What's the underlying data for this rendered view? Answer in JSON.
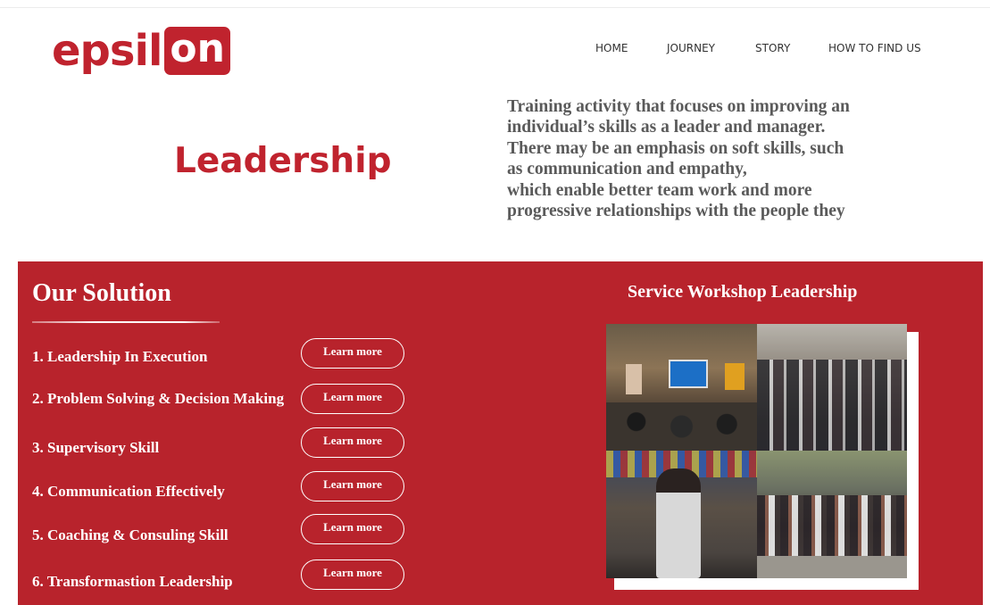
{
  "logo": {
    "text_main": "epsil",
    "text_box": "on"
  },
  "nav": [
    {
      "label": "HOME"
    },
    {
      "label": "JOURNEY"
    },
    {
      "label": "STORY"
    },
    {
      "label": "HOW TO FIND US"
    }
  ],
  "hero": {
    "title": "Leadership",
    "description": "Training activity that focuses on improving an\nindividual’s skills as a leader and manager.\n There may be an emphasis on soft skills, such\nas communication and empathy,\nwhich enable better team work and more\nprogressive relationships with the people they"
  },
  "solution": {
    "title": "Our Solution",
    "items": [
      {
        "label": "1. Leadership In Execution",
        "button": "Learn more"
      },
      {
        "label": "2. Problem Solving & Decision Making",
        "button": "Learn more"
      },
      {
        "label": "3. Supervisory Skill",
        "button": "Learn more"
      },
      {
        "label": "4. Communication Effectively",
        "button": "Learn more"
      },
      {
        "label": "5. Coaching & Consuling Skill",
        "button": "Learn more"
      },
      {
        "label": "6. Transformastion Leadership",
        "button": "Learn more"
      }
    ]
  },
  "service": {
    "title": "Service Workshop Leadership"
  },
  "colors": {
    "brand_red": "#c0232e",
    "band_red": "#b8232c",
    "text_gray": "#5a5a5a"
  }
}
